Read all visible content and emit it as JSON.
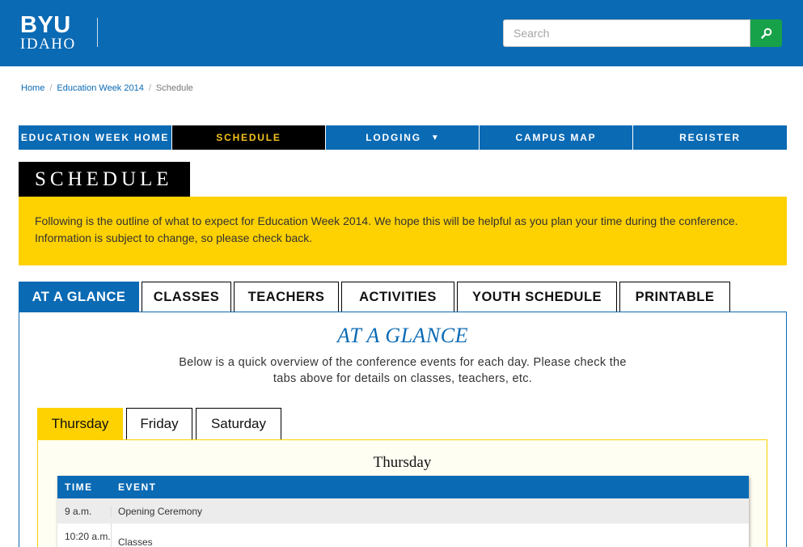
{
  "header": {
    "logo_line1": "BYU",
    "logo_line2": "IDAHO",
    "search_placeholder": "Search",
    "brand_color": "#0a6ab4",
    "search_button_color": "#17a148",
    "search_icon": "search-icon"
  },
  "breadcrumb": {
    "items": [
      "Home",
      "Education Week 2014",
      "Schedule"
    ]
  },
  "nav": {
    "items": [
      "EDUCATION WEEK HOME",
      "SCHEDULE",
      "LODGING",
      "CAMPUS MAP",
      "REGISTER"
    ],
    "active": "SCHEDULE",
    "lodging_caret": "▼"
  },
  "page_title": "SCHEDULE",
  "banner": {
    "text": "Following is the outline of what to expect for Education Week 2014. We hope this will be helpful as you plan your time during the conference. Information is subject to change, so please check back.",
    "color": "#fed100"
  },
  "tabs": {
    "items": [
      "AT A GLANCE",
      "CLASSES",
      "TEACHERS",
      "ACTIVITIES",
      "YOUTH SCHEDULE",
      "PRINTABLE"
    ],
    "active": "AT A GLANCE"
  },
  "glance": {
    "title": "AT A GLANCE",
    "description": "Below is a quick overview of the conference events for each day. Please check the tabs above for details on classes, teachers, etc."
  },
  "day_tabs": {
    "items": [
      "Thursday",
      "Friday",
      "Saturday"
    ],
    "active": "Thursday"
  },
  "day_panel": {
    "heading": "Thursday",
    "columns": [
      "TIME",
      "EVENT"
    ],
    "rows": [
      {
        "time": "9 a.m.",
        "event": "Opening Ceremony"
      },
      {
        "time": "10:20 a.m.",
        "event": "Classes"
      }
    ]
  }
}
